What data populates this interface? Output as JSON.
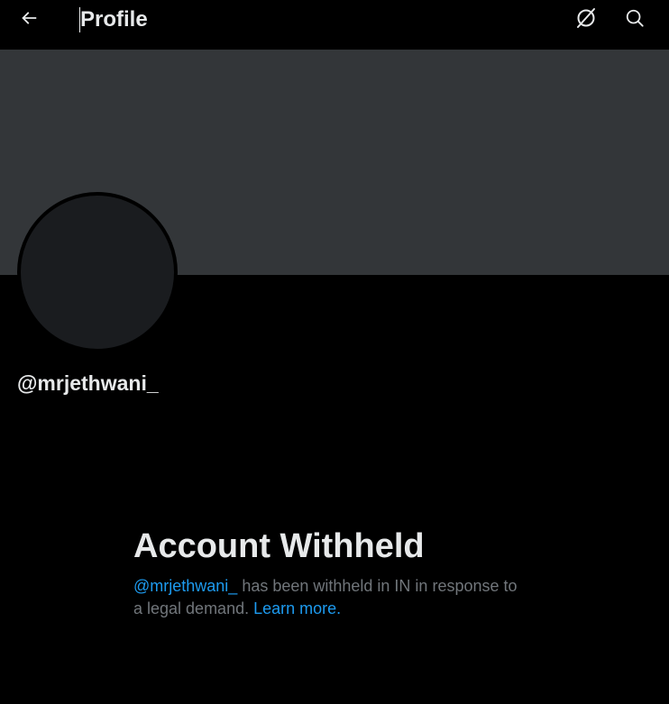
{
  "header": {
    "title": "Profile",
    "back_icon": "arrow-left-icon",
    "grok_icon": "grok-icon",
    "search_icon": "search-icon"
  },
  "profile": {
    "handle": "@mrjethwani_"
  },
  "withheld": {
    "title": "Account Withheld",
    "handle_link": "@mrjethwani_",
    "message": " has been withheld in IN in response to a legal demand. ",
    "learn_more": "Learn more."
  },
  "colors": {
    "background": "#000000",
    "banner": "#333639",
    "avatar": "#1a1c1f",
    "text_primary": "#e7e9ea",
    "text_secondary": "#71767b",
    "link": "#1d9bf0"
  }
}
